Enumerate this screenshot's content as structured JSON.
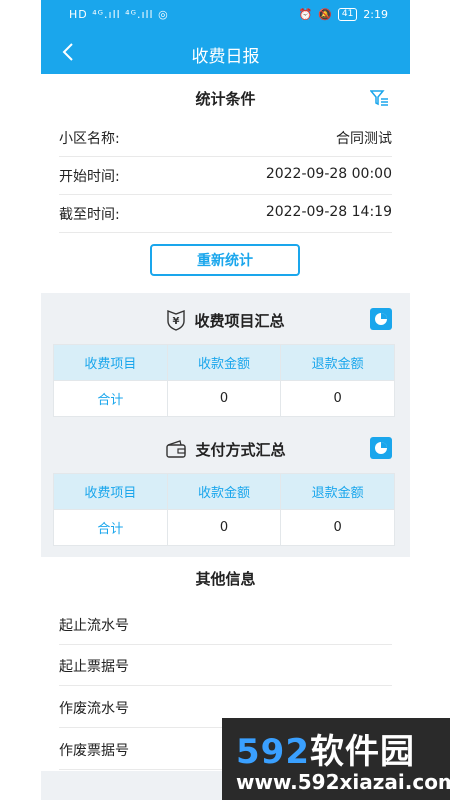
{
  "status_bar": {
    "left": "HD ⁴ᴳ.ıll ⁴ᴳ.ıll ◎",
    "battery": "41",
    "time": "2:19"
  },
  "header": {
    "title": "收费日报"
  },
  "conditions": {
    "title": "统计条件",
    "rows": [
      {
        "label": "小区名称:",
        "value": "合同测试"
      },
      {
        "label": "开始时间:",
        "value": "2022-09-28 00:00"
      },
      {
        "label": "截至时间:",
        "value": "2022-09-28 14:19"
      }
    ],
    "recalc_label": "重新统计"
  },
  "fee_summary": {
    "title": "收费项目汇总",
    "columns": [
      "收费项目",
      "收款金额",
      "退款金额"
    ],
    "rows": [
      [
        "合计",
        "0",
        "0"
      ]
    ]
  },
  "payment_summary": {
    "title": "支付方式汇总",
    "columns": [
      "收费项目",
      "收款金额",
      "退款金额"
    ],
    "rows": [
      [
        "合计",
        "0",
        "0"
      ]
    ]
  },
  "other_info": {
    "title": "其他信息",
    "items": [
      "起止流水号",
      "起止票据号",
      "作废流水号",
      "作废票据号"
    ]
  },
  "watermark": {
    "brand_nums": "592",
    "brand_text": "软件园",
    "url": "www.592xiazai.com"
  },
  "colors": {
    "primary": "#1aa6ec",
    "section_bg": "#eef1f4",
    "table_head": "#d8eef8"
  }
}
